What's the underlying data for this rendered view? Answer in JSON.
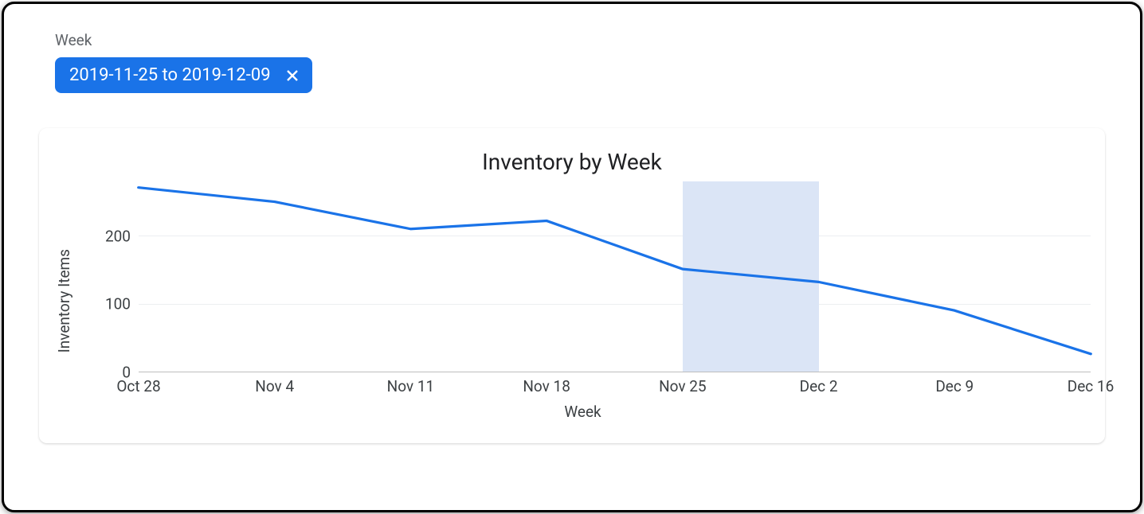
{
  "filter": {
    "label": "Week",
    "chip_text": "2019-11-25 to 2019-12-09"
  },
  "chart_data": {
    "type": "line",
    "title": "Inventory by Week",
    "xlabel": "Week",
    "ylabel": "Inventory Items",
    "categories": [
      "Oct 28",
      "Nov 4",
      "Nov 11",
      "Nov 18",
      "Nov 25",
      "Dec 2",
      "Dec 9",
      "Dec 16"
    ],
    "values": [
      271,
      250,
      210,
      222,
      151,
      132,
      90,
      26
    ],
    "ylim": [
      0,
      280
    ],
    "yticks": [
      0,
      100,
      200
    ],
    "highlight_range": [
      "Nov 25",
      "Dec 2"
    ]
  }
}
